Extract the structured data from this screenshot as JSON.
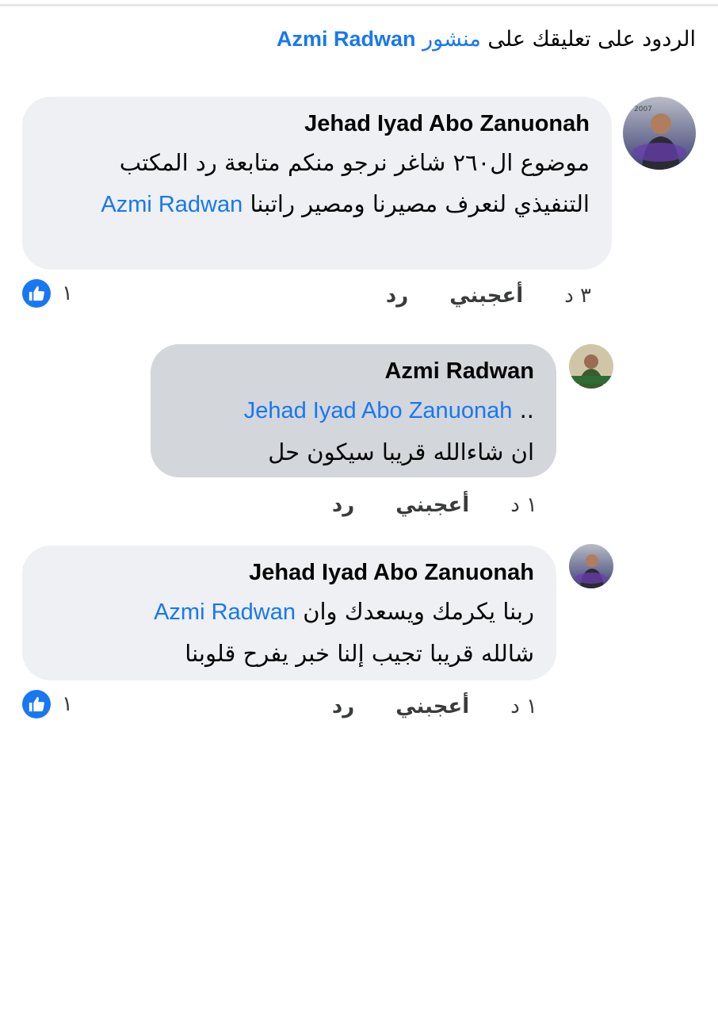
{
  "header": {
    "prefix": "الردود على تعليقك على",
    "post_word": "منشور",
    "post_author": "Azmi Radwan"
  },
  "comments": [
    {
      "author": "Jehad Iyad Abo Zanuonah",
      "text": "موضوع ال٢٦٠ شاغر نرجو منكم متابعة رد المكتب التنفيذي لنعرف مصيرنا ومصير راتبنا",
      "mention": "Azmi Radwan",
      "time": "٣ د",
      "like_label": "أعجبني",
      "reply_label": "رد",
      "reaction_count": "١",
      "reaction_icon": "like-icon",
      "avatar_icon": "profile-photo"
    },
    {
      "author": "Azmi Radwan",
      "mention": "Jehad Iyad Abo Zanuonah",
      "mention_suffix": "..",
      "text": "ان شاءالله قريبا سيكون حل",
      "time": "١ د",
      "like_label": "أعجبني",
      "reply_label": "رد",
      "avatar_icon": "profile-photo"
    },
    {
      "author": "Jehad Iyad Abo Zanuonah",
      "text_before": "ربنا يكرمك ويسعدك وان",
      "mention": "Azmi Radwan",
      "text_after": "شالله قريبا تجيب إلنا خبر يفرح قلوبنا",
      "time": "١ د",
      "like_label": "أعجبني",
      "reply_label": "رد",
      "reaction_count": "١",
      "reaction_icon": "like-icon",
      "avatar_icon": "profile-photo"
    }
  ],
  "colors": {
    "link": "#1877f2",
    "bubble_light": "#eef0f3",
    "bubble_highlight": "#d3d6db"
  }
}
